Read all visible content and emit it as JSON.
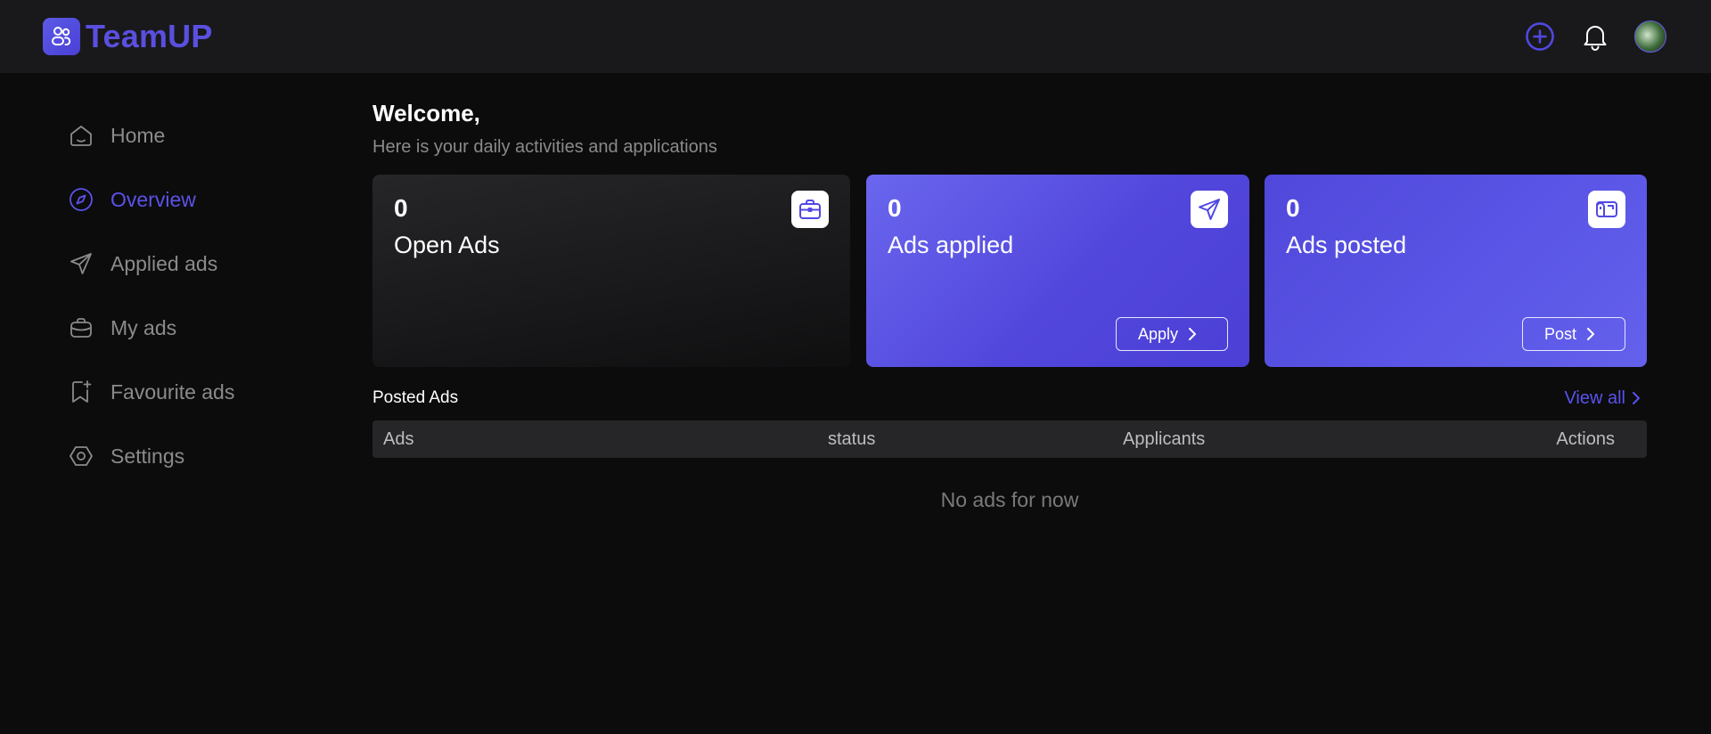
{
  "brand": {
    "name": "TeamUP",
    "accent": "#5a4fe0"
  },
  "header": {
    "icons": [
      "plus-circle-icon",
      "bell-icon",
      "avatar"
    ]
  },
  "sidebar": {
    "items": [
      {
        "label": "Home",
        "icon": "home-icon",
        "active": false
      },
      {
        "label": "Overview",
        "icon": "compass-icon",
        "active": true
      },
      {
        "label": "Applied ads",
        "icon": "send-icon",
        "active": false
      },
      {
        "label": "My ads",
        "icon": "briefcase-icon",
        "active": false
      },
      {
        "label": "Favourite ads",
        "icon": "bookmark-plus-icon",
        "active": false
      },
      {
        "label": "Settings",
        "icon": "settings-icon",
        "active": false
      }
    ]
  },
  "main": {
    "welcome": "Welcome,",
    "subtitle": "Here is your daily activities and applications",
    "cards": [
      {
        "count": "0",
        "label": "Open Ads",
        "icon": "briefcase-icon"
      },
      {
        "count": "0",
        "label": "Ads applied",
        "icon": "send-icon",
        "button": "Apply"
      },
      {
        "count": "0",
        "label": "Ads posted",
        "icon": "mailbox-icon",
        "button": "Post"
      }
    ],
    "posted": {
      "title": "Posted Ads",
      "view_all": "View all",
      "columns": [
        "Ads",
        "status",
        "Applicants",
        "Actions"
      ],
      "empty": "No ads for now"
    }
  }
}
